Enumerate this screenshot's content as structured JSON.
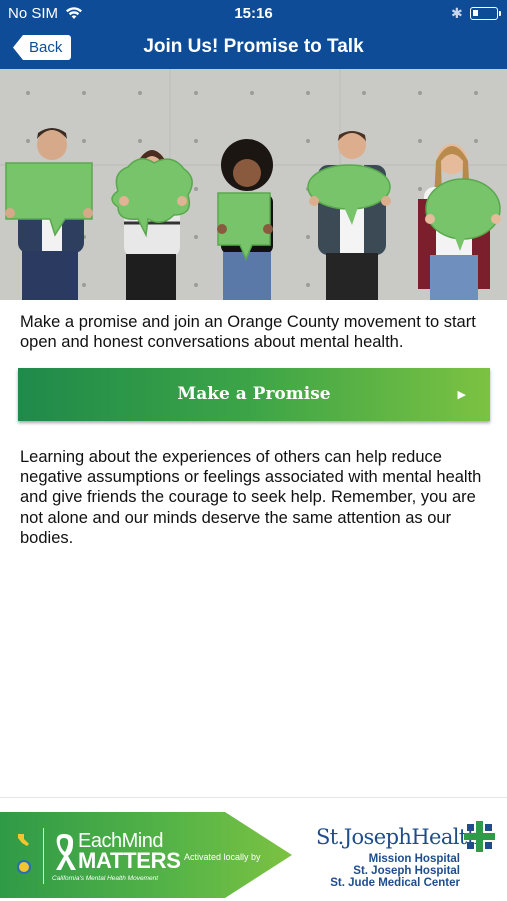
{
  "status_bar": {
    "carrier": "No SIM",
    "time": "15:16",
    "icons": [
      "wifi-icon",
      "bluetooth-icon",
      "battery-icon"
    ]
  },
  "nav": {
    "back_label": "Back",
    "title": "Join Us! Promise to Talk"
  },
  "hero": {
    "image": "five young people holding green speech-bubble signs against a concrete wall"
  },
  "content": {
    "intro": "Make a promise and join an Orange County movement to start open and honest conversations about mental health.",
    "cta_label": "Make a Promise",
    "cta_icon": "chevron-right-icon",
    "body": "Learning about the experiences of others can help reduce negative assumptions or feelings associated with mental health and give friends the courage to seek help. Remember, you are not alone and our minds deserve the same attention as our bodies."
  },
  "footer": {
    "emm_each": "EachMind",
    "emm_matters": "MATTERS",
    "emm_tagline": "California's Mental Health Movement",
    "activated": "Activated locally by",
    "sjh_name": "St.JosephHealth",
    "hospitals": [
      "Mission Hospital",
      "St. Joseph Hospital",
      "St. Jude Medical Center"
    ]
  },
  "colors": {
    "nav_blue": "#0f4c97",
    "green_dark": "#1f8a4a",
    "green_light": "#7cc242",
    "sjh_blue": "#1f4d8c"
  }
}
